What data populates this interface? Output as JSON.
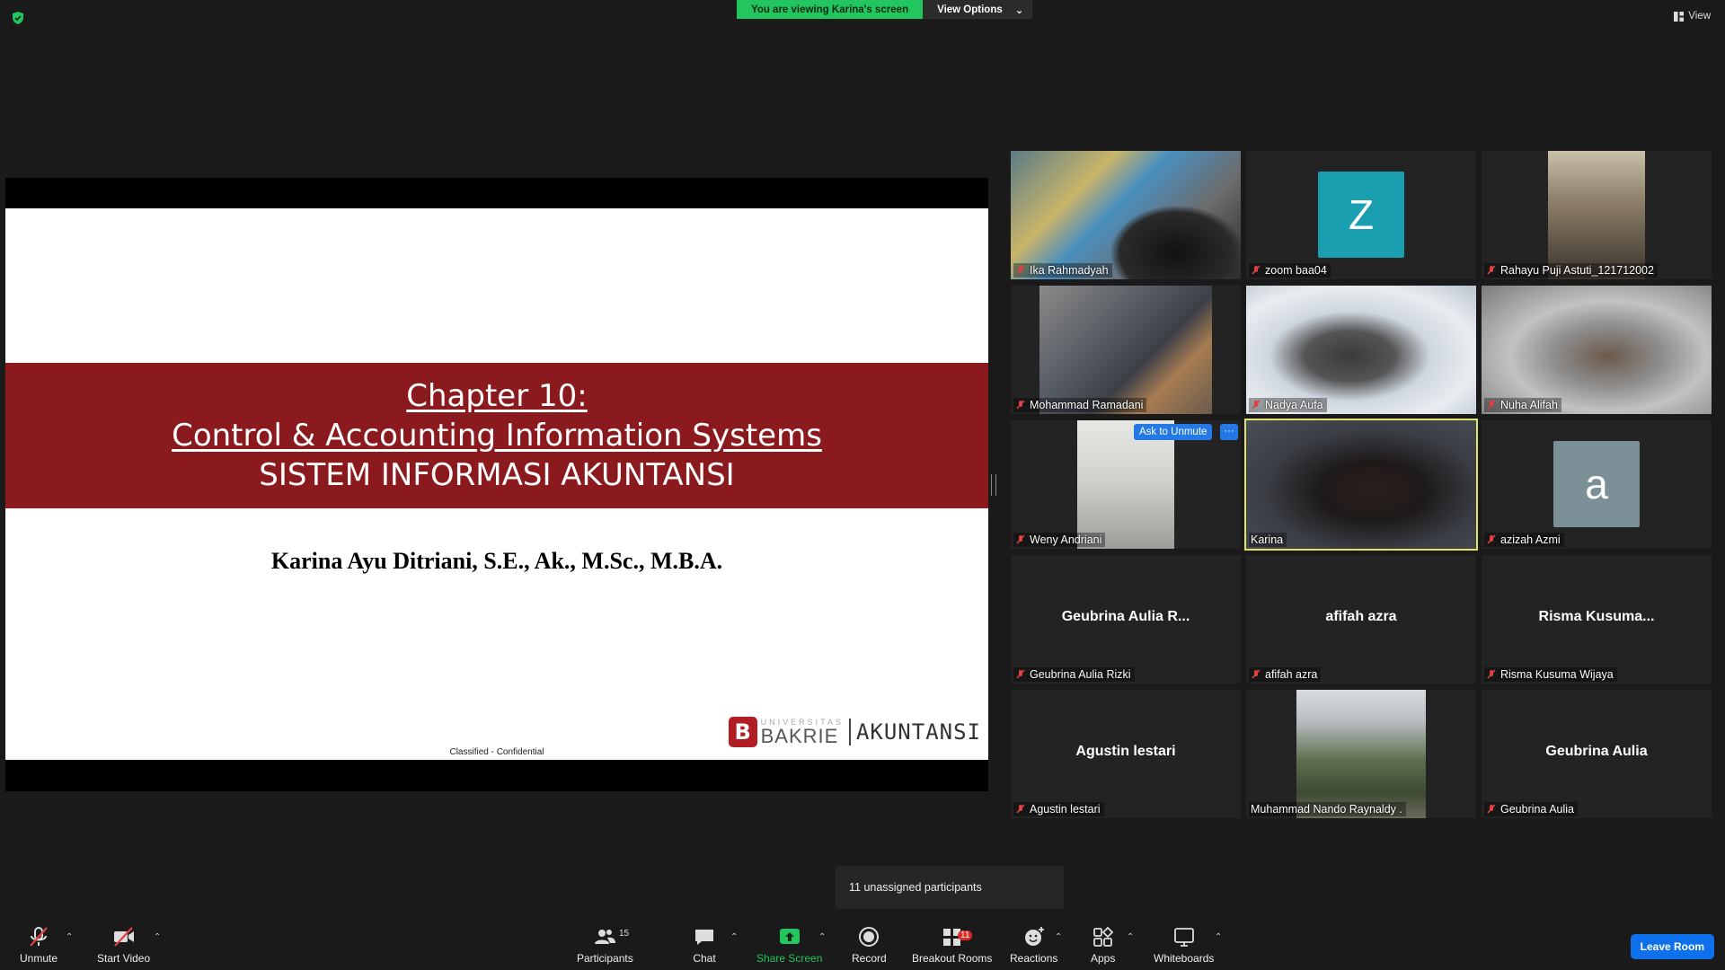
{
  "topbar": {
    "viewing_text": "You are viewing Karina's screen",
    "view_options_label": "View Options",
    "view_label": "View",
    "accent_green": "#23c55e"
  },
  "slide": {
    "title_line1": "Chapter 10:",
    "title_line2": "Control & Accounting Information Systems",
    "title_line3": "SISTEM INFORMASI AKUNTANSI",
    "author": "Karina Ayu Ditriani, S.E., Ak., M.Sc., M.B.A.",
    "footer": "Classified - Confidential",
    "logo_universitas": "UNIVERSITAS",
    "logo_bakrie": "BAKRIE",
    "logo_akuntansi": "AKUNTANSI",
    "logo_letter": "B",
    "banner_color": "#8b1a1f"
  },
  "participants": [
    {
      "name": "Ika Rahmadyah"
    },
    {
      "name": "zoom baa04",
      "avatar_letter": "Z",
      "avatar_color": "#1a9fb0"
    },
    {
      "name": "Rahayu Puji Astuti_121712002"
    },
    {
      "name": "Mohammad Ramadani"
    },
    {
      "name": "Nadya Aufa"
    },
    {
      "name": "Nuha Alifah"
    },
    {
      "name": "Weny Andriani",
      "ask_to_unmute": "Ask to Unmute",
      "more": "···"
    },
    {
      "name": "Karina"
    },
    {
      "name": "azizah Azmi",
      "avatar_letter": "a",
      "avatar_color": "#7b8f96"
    },
    {
      "name": "Geubrina Aulia Rizki",
      "display": "Geubrina  Aulia  R..."
    },
    {
      "name": "afifah azra",
      "display": "afifah azra"
    },
    {
      "name": "Risma Kusuma Wijaya",
      "display": "Risma  Kusuma..."
    },
    {
      "name": "Agustin lestari",
      "display": "Agustin lestari"
    },
    {
      "name": "Muhammad Nando Raynaldy ."
    },
    {
      "name": "Geubrina Aulia",
      "display": "Geubrina Aulia"
    }
  ],
  "toast": {
    "text": "11 unassigned participants"
  },
  "toolbar": {
    "unmute": "Unmute",
    "start_video": "Start Video",
    "participants": "Participants",
    "participants_count": "15",
    "chat": "Chat",
    "share_screen": "Share Screen",
    "record": "Record",
    "breakout_rooms": "Breakout Rooms",
    "breakout_count": "11",
    "reactions": "Reactions",
    "apps": "Apps",
    "whiteboards": "Whiteboards",
    "leave_room": "Leave Room"
  }
}
